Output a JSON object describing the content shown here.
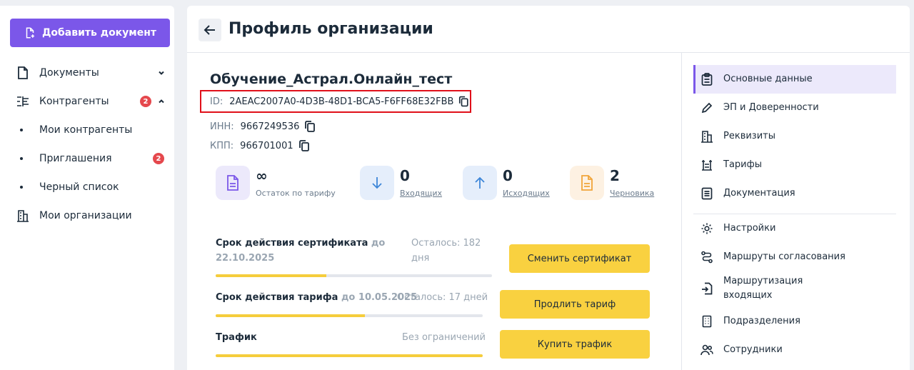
{
  "sidebar": {
    "add_button": "Добавить документ",
    "items": [
      {
        "label": "Документы"
      },
      {
        "label": "Контрагенты",
        "badge": "2"
      },
      {
        "label": "Мои контрагенты"
      },
      {
        "label": "Приглашения",
        "badge": "2"
      },
      {
        "label": "Черный список"
      },
      {
        "label": "Мои организации"
      }
    ]
  },
  "header": {
    "title": "Профиль организации"
  },
  "org": {
    "name": "Обучение_Астрал.Онлайн_тест",
    "id_label": "ID:",
    "id_value": "2AEAC2007A0-4D3B-48D1-BCA5-F6FF68E32FBB",
    "inn_label": "ИНН:",
    "inn_value": "9667249536",
    "kpp_label": "КПП:",
    "kpp_value": "966701001"
  },
  "stats": [
    {
      "value": "∞",
      "label": "Остаток по тарифу"
    },
    {
      "value": "0",
      "label": "Входящих"
    },
    {
      "value": "0",
      "label": "Исходящих"
    },
    {
      "value": "2",
      "label": "Черновика"
    }
  ],
  "terms": {
    "cert": {
      "title": "Срок действия сертификата",
      "until": "до 22.10.2025",
      "remaining": "Осталось: 182 дня",
      "button": "Сменить сертификат",
      "progress": 0.4
    },
    "tariff": {
      "title": "Срок действия тарифа",
      "until": "до 10.05.2025",
      "remaining": "Осталось: 17 дней",
      "button": "Продлить тариф",
      "progress": 0.56
    },
    "traffic": {
      "title": "Трафик",
      "remaining": "Без ограничений",
      "button": "Купить трафик",
      "progress": 1.0
    }
  },
  "right_menu": [
    {
      "label": "Основные данные"
    },
    {
      "label": "ЭП и Доверенности"
    },
    {
      "label": "Реквизиты"
    },
    {
      "label": "Тарифы"
    },
    {
      "label": "Документация"
    },
    {
      "label": "Настройки"
    },
    {
      "label": "Маршруты согласования"
    },
    {
      "label": "Маршрутизация входящих"
    },
    {
      "label": "Подразделения"
    },
    {
      "label": "Сотрудники"
    }
  ],
  "colors": {
    "accent": "#7b57e9",
    "yellow": "#f9d140",
    "badge": "#e5484d",
    "highlight": "#e0101a"
  }
}
